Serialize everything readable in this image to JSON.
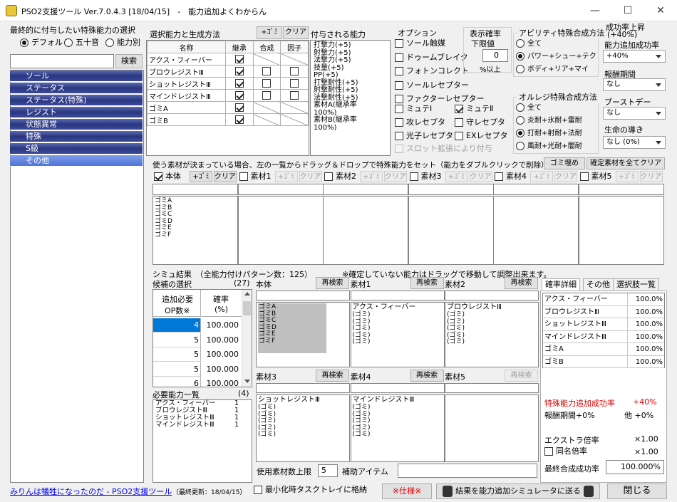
{
  "window": {
    "title": "PSO2支援ツール Ver.7.0.4.3 [18/04/15]　-　能力追加よくわからん",
    "minimize": "—",
    "maximize": "☐",
    "close": "✕"
  },
  "left": {
    "heading": "最終的に付与したい特殊能力の選択",
    "radios": [
      "デフォルト",
      "五十音",
      "能力別"
    ],
    "search_label": "検索",
    "search_value": "",
    "categories": [
      "ソール",
      "ステータス",
      "ステータス(特殊)",
      "レジスト",
      "状態異常",
      "特殊",
      "S級",
      "その他"
    ]
  },
  "sel": {
    "heading": "選択能力と生成方法",
    "add_btn": "+ｺﾞﾐ",
    "clear_btn": "クリア",
    "cols": [
      "名称",
      "継承",
      "合成",
      "因子"
    ],
    "rows": [
      {
        "name": "アクス・フィーバー",
        "inherit": true,
        "synth": false,
        "factor": false,
        "type": "a"
      },
      {
        "name": "ブロウレジストⅢ",
        "inherit": true,
        "synth": false,
        "factor": false,
        "type": "b"
      },
      {
        "name": "ショットレジストⅢ",
        "inherit": true,
        "synth": false,
        "factor": false,
        "type": "b"
      },
      {
        "name": "マインドレジストⅢ",
        "inherit": true,
        "synth": false,
        "factor": false,
        "type": "b"
      },
      {
        "name": "ゴミA",
        "inherit": true,
        "type": "c"
      },
      {
        "name": "ゴミB",
        "inherit": true,
        "type": "c"
      }
    ]
  },
  "granted": {
    "heading": "付与される能力",
    "text": "打撃力(+5)\n射撃力(+5)\n法撃力(+5)\n技量(+5)\nPP(+5)\n打撃耐性(+5)\n射撃耐性(+5)\n法撃耐性(+5)\n素材A(継承率\n100%)\n素材B(継承率\n100%)"
  },
  "options": {
    "heading": "オプション",
    "items": [
      {
        "label": "ソール触媒",
        "on": false
      },
      {
        "label": "ドゥームブレイク",
        "on": false
      },
      {
        "label": "フォトンコレクト",
        "on": false
      },
      {
        "label": "ソールレセプター",
        "on": false
      },
      {
        "label": "ファクターレセプター",
        "on": false
      }
    ],
    "pairs": [
      [
        {
          "label": "ミュテⅠ",
          "on": false
        },
        {
          "label": "ミュテⅡ",
          "on": true
        }
      ],
      [
        {
          "label": "攻レセプタ",
          "on": false
        },
        {
          "label": "守レセプタ",
          "on": false
        }
      ],
      [
        {
          "label": "光子レセプタ",
          "on": false
        },
        {
          "label": "EXレセプタ",
          "on": false
        }
      ]
    ],
    "slot_label": "スロット拡張により付与"
  },
  "display_rate": {
    "heading": "表示確率",
    "sub": "下限値",
    "value": "0",
    "suffix": "%以上"
  },
  "ability": {
    "heading": "アビリティ特殊合成方法",
    "items": [
      "全て",
      "パワー+シュー+テク",
      "ボディ+リア+マイ"
    ],
    "selected": 1
  },
  "orphe": {
    "heading": "オルレジ特殊合成方法",
    "items": [
      "全て",
      "炎耐+氷耐+雷耐",
      "打耐+射耐+法耐",
      "風耐+光耐+闇耐"
    ],
    "selected": 2
  },
  "right": {
    "heading1": "成功率上昇",
    "heading2": "(+40%)",
    "boost_label": "能力追加成功率",
    "boost_value": "+40%",
    "reward_label": "報酬期間",
    "reward_value": "なし",
    "boostday_label": "ブーストデー",
    "boostday_value": "なし",
    "guide_label": "生命の導き",
    "guide_value": "なし (0%)"
  },
  "materials": {
    "hint": "使う素材が決まっている場合、左の一覧からドラッグ＆ドロップで特殊能力をセット（能力をダブルクリックで削除）",
    "fill_btn": "ゴミ埋め",
    "clear_all_btn": "確定素材を全てクリア",
    "add_btn": "+ｺﾞﾐ",
    "clear_btn": "クリア",
    "cols": [
      {
        "label": "本体",
        "on": true,
        "items": [
          "ゴミA",
          "ゴミB",
          "ゴミC",
          "ゴミD",
          "ゴミE",
          "ゴミF"
        ]
      },
      {
        "label": "素材1",
        "on": false
      },
      {
        "label": "素材2",
        "on": false
      },
      {
        "label": "素材3",
        "on": false
      },
      {
        "label": "素材4",
        "on": false
      },
      {
        "label": "素材5",
        "on": false
      }
    ]
  },
  "sim": {
    "heading": "シミュ結果　（全能力付けパターン数：125）",
    "note": "※確定していない能力はドラッグで移動して調整出来ます。",
    "cand_label": "候補の選択",
    "cand_count": "(27)",
    "cand_col1a": "追加必要",
    "cand_col1b": "OP数※",
    "cand_col2a": "確率",
    "cand_col2b": "(%)",
    "cand_rows": [
      [
        "4",
        "100.000"
      ],
      [
        "5",
        "100.000"
      ],
      [
        "5",
        "100.000"
      ],
      [
        "5",
        "100.000"
      ],
      [
        "6",
        "100.000"
      ]
    ],
    "req_label": "必要能力一覧",
    "req_count": "(4)",
    "req_rows": [
      [
        "アクス・フィーバー",
        "1"
      ],
      [
        "ブロウレジストⅢ",
        "1"
      ],
      [
        "ショットレジストⅢ",
        "1"
      ],
      [
        "マインドレジストⅢ",
        "1"
      ]
    ],
    "research": "再検索",
    "panels": [
      {
        "label": "本体",
        "name": "",
        "items": "ゴミA\nゴミB\nゴミC\nゴミD\nゴミE\nゴミF",
        "gray": true
      },
      {
        "label": "素材1",
        "name": "アクス・フィーバー",
        "items": "(ゴミ)\n(ゴミ)\n(ゴミ)\n(ゴミ)\n(ゴミ)"
      },
      {
        "label": "素材2",
        "name": "ブロウレジストⅢ",
        "items": "(ゴミ)\n(ゴミ)\n(ゴミ)\n(ゴミ)\n(ゴミ)"
      },
      {
        "label": "素材3",
        "name": "ショットレジストⅢ",
        "items": "(ゴミ)\n(ゴミ)\n(ゴミ)\n(ゴミ)\n(ゴミ)"
      },
      {
        "label": "素材4",
        "name": "マインドレジストⅢ",
        "items": "(ゴミ)\n(ゴミ)\n(ゴミ)\n(ゴミ)\n(ゴミ)"
      },
      {
        "label": "素材5",
        "name": "",
        "items": ""
      }
    ],
    "use_limit_label": "使用素材数上限",
    "use_limit_value": "5",
    "aux_label": "補助アイテム"
  },
  "detail": {
    "tabs": [
      "確率詳細",
      "その他",
      "選択肢一覧"
    ],
    "rows": [
      [
        "アクス・フィーバー",
        "100.0%"
      ],
      [
        "ブロウレジストⅢ",
        "100.0%"
      ],
      [
        "ショットレジストⅢ",
        "100.0%"
      ],
      [
        "マインドレジストⅢ",
        "100.0%"
      ],
      [
        "ゴミA",
        "100.0%"
      ],
      [
        "ゴミB",
        "100.0%"
      ]
    ],
    "special_label": "特殊能力追加成功率",
    "special_value": "+40%",
    "reward_label": "報酬期間+0%",
    "other_label": "他 +0%",
    "extra_label": "エクストラ倍率",
    "extra_value": "×1.00",
    "same_label": "同名倍率",
    "same_value": "×1.00",
    "final_label": "最終合成成功率",
    "final_value": "100.000%"
  },
  "footer": {
    "link": "みりんは犠牲になったのだ - PSO2支援ツール",
    "updated": "（最終更新：18/04/15）",
    "tray_label": "最小化時タスクトレイに格納",
    "spec_btn": "※仕様※",
    "send_btn": "結果を能力追加シミュレータに送る",
    "close_btn": "閉じる"
  }
}
